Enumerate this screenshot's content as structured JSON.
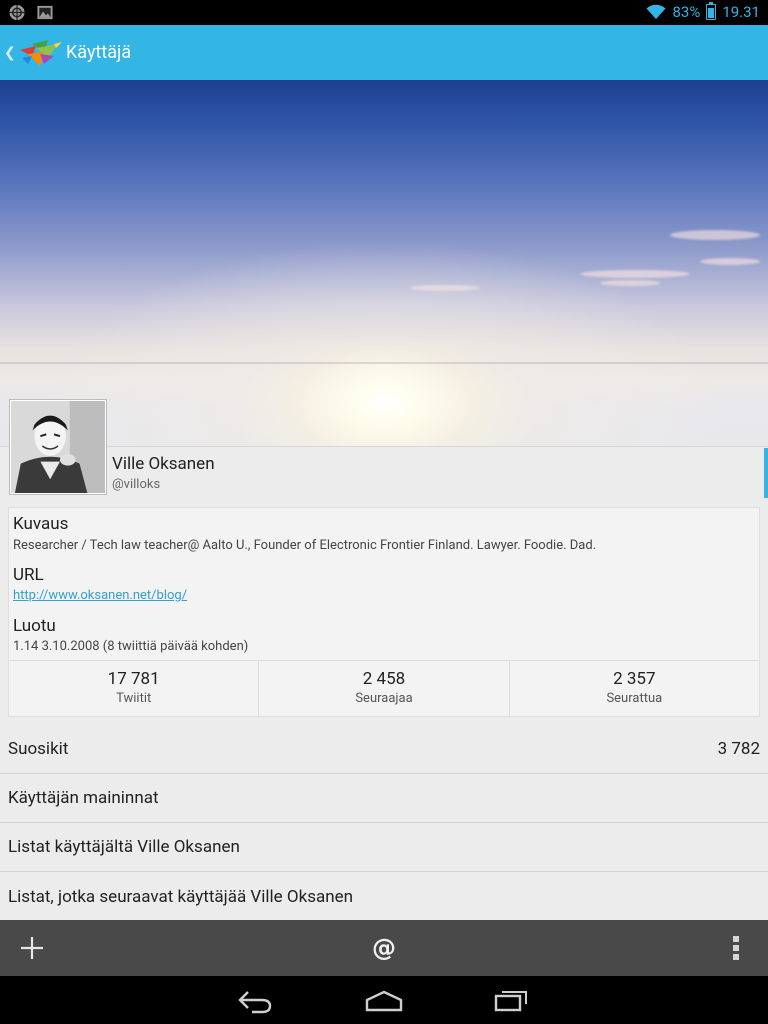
{
  "status_bar": {
    "battery": "83%",
    "battery_level": 0.83,
    "time": "19.31",
    "icons_left": [
      "notification-icon",
      "image-icon"
    ],
    "accent_color": "#33b5e5"
  },
  "action_bar": {
    "title": "Käyttäjä",
    "color": "#33b5e5"
  },
  "profile": {
    "name": "Ville Oksanen",
    "handle": "@villoks"
  },
  "details": {
    "description_label": "Kuvaus",
    "description": "Researcher / Tech law teacher@ Aalto U., Founder of Electronic Frontier Finland. Lawyer. Foodie. Dad.",
    "url_label": "URL",
    "url": "http://www.oksanen.net/blog/",
    "created_label": "Luotu",
    "created": "1.14 3.10.2008 (8 twiittiä päivää kohden)"
  },
  "stats": [
    {
      "value": "17 781",
      "label": "Twiitit"
    },
    {
      "value": "2 458",
      "label": "Seuraajaa"
    },
    {
      "value": "2 357",
      "label": "Seurattua"
    }
  ],
  "list": {
    "favorites_label": "Suosikit",
    "favorites_count": "3 782",
    "mentions_label": "Käyttäjän maininnat",
    "lists_by_label": "Listat käyttäjältä Ville Oksanen",
    "lists_following_label": "Listat, jotka seuraavat käyttäjää Ville Oksanen"
  },
  "bottom_bar": {
    "icons": [
      "add-icon",
      "mention-icon",
      "overflow-menu-icon"
    ]
  },
  "nav_bar": {
    "icons": [
      "back-icon",
      "home-icon",
      "recent-apps-icon"
    ]
  }
}
